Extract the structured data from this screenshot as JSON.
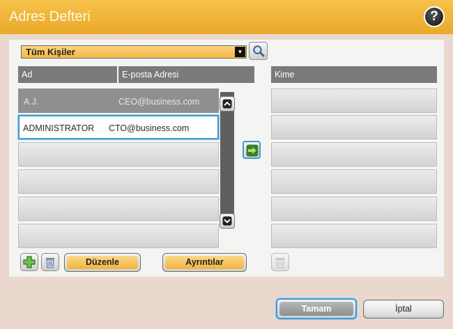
{
  "header": {
    "title": "Adres Defteri",
    "help_icon": "question-circle-icon",
    "help_glyph": "?"
  },
  "filter": {
    "selected": "Tüm Kişiler"
  },
  "contacts_table": {
    "columns": [
      "Ad",
      "E-posta Adresi"
    ],
    "rows": [
      {
        "name": "A.J.",
        "email": "CEO@business.com"
      },
      {
        "name": "ADMINISTRATOR",
        "email": "CTO@business.com"
      }
    ]
  },
  "recipients": {
    "header": "Kime"
  },
  "actions": {
    "edit_label": "Düzenle",
    "details_label": "Ayrıntılar",
    "ok_label": "Tamam",
    "cancel_label": "İptal"
  },
  "colors": {
    "accent": "#eaa92a",
    "selection": "#3d9ad6"
  }
}
